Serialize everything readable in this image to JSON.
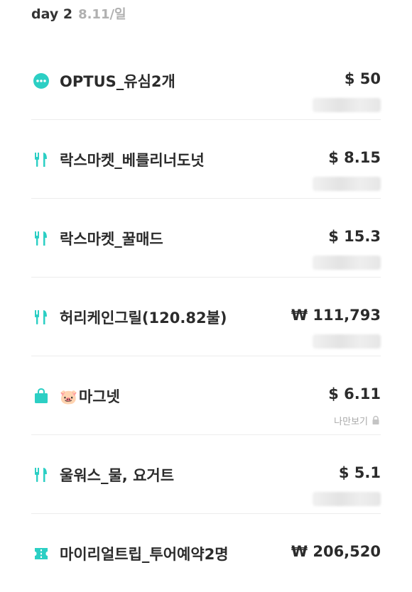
{
  "header": {
    "day": "day 2",
    "date": "8.11/일"
  },
  "colors": {
    "accent": "#2ccfc4",
    "text": "#2b2b2b",
    "muted": "#b0b0b0"
  },
  "expenses": [
    {
      "icon": "more-dots-icon",
      "name": "OPTUS_유심2개",
      "amount": "$ 50"
    },
    {
      "icon": "fork-knife-icon",
      "name": "락스마켓_베를리너도넛",
      "amount": "$ 8.15"
    },
    {
      "icon": "fork-knife-icon",
      "name": "락스마켓_꿀매드",
      "amount": "$ 15.3"
    },
    {
      "icon": "fork-knife-icon",
      "name": "허리케인그릴(120.82불)",
      "amount": "₩ 111,793"
    },
    {
      "icon": "shopping-bag-icon",
      "name_emoji": "🐷",
      "name": "마그넷",
      "amount": "$ 6.11",
      "private_label": "나만보기"
    },
    {
      "icon": "fork-knife-icon",
      "name": "울워스_물, 요거트",
      "amount": "$ 5.1"
    },
    {
      "icon": "ticket-icon",
      "name": "마이리얼트립_투어예약2명",
      "amount": "₩ 206,520"
    }
  ]
}
